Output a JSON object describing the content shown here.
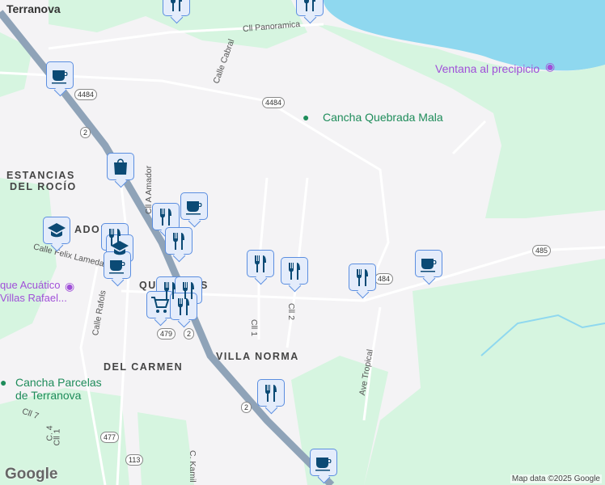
{
  "labels": {
    "terranova": "Terranova",
    "panoramica": "Cll Panoramica",
    "cabral": "Calle Cabral",
    "ventana": "Ventana al precipicio",
    "cancha_qm": "Cancha Quebrada Mala",
    "estancias1": "ESTANCIAS",
    "estancias2": "DEL ROCÍO",
    "ador": "ADOR",
    "felix": "Calle Felix Lameda",
    "acuatico1": "que Acuático",
    "acuatico2": "Villas Rafael...",
    "que": "QUE",
    "que_s": "S",
    "amador": "Cll A Amador",
    "cll1": "Cll 1",
    "cll2": "Cll 2",
    "tropical": "Ave Tropical",
    "villa_norma": "VILLA NORMA",
    "del_carmen": "DEL CARMEN",
    "parcelas1": "Cancha Parcelas",
    "parcelas2": "de Terranova",
    "cll7": "Cll 7",
    "c4": "C. 4",
    "cll1b": "Cll 1",
    "kamil": "C. Kamil",
    "rafols": "Calle Rafols"
  },
  "shields": {
    "r4484a": "4484",
    "r4484b": "4484",
    "r2a": "2",
    "r479": "479",
    "r2b": "2",
    "r477": "477",
    "r113": "113",
    "r485": "485",
    "r2c": "2",
    "r484": "484"
  },
  "footer": {
    "logo": "Google",
    "attribution": "Map data ©2025 Google"
  },
  "colors": {
    "water": "#8fd8ef",
    "park": "#d6f5e0",
    "highway": "#8fa3b8",
    "marker": "#0b4a75"
  }
}
